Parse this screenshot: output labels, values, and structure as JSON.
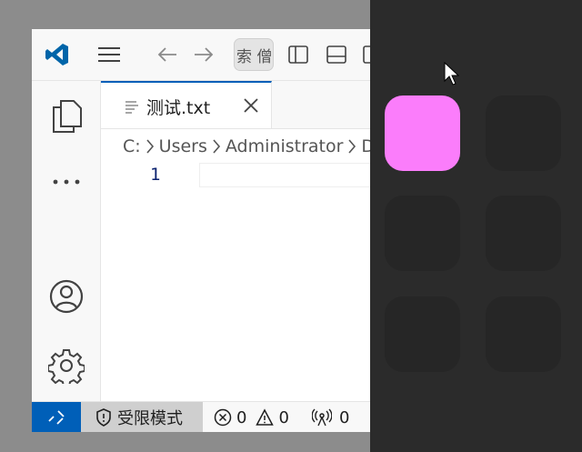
{
  "editor": {
    "tab_label": "测试.txt",
    "search_text": "索 僧",
    "breadcrumb": [
      "C:",
      "Users",
      "Administrator",
      "D"
    ],
    "line_number": "1"
  },
  "statusbar": {
    "restricted_label": "受限模式",
    "errors": "0",
    "warnings": "0",
    "ports": "0"
  },
  "colors": {
    "accent": "#005fb8",
    "logo": "#0065a9",
    "active_tile": "#fb7dfb",
    "panel_bg": "#2b2b2b"
  },
  "icons": [
    "vscode-logo-icon",
    "menu-icon",
    "arrow-left-icon",
    "arrow-right-icon",
    "layout-sidebar-icon",
    "layout-panel-icon",
    "explorer-icon",
    "ellipsis-icon",
    "account-icon",
    "gear-icon",
    "file-text-icon",
    "close-icon",
    "chevron-right-icon",
    "remote-icon",
    "shield-icon",
    "error-icon",
    "warning-icon",
    "broadcast-icon",
    "cursor-icon"
  ]
}
